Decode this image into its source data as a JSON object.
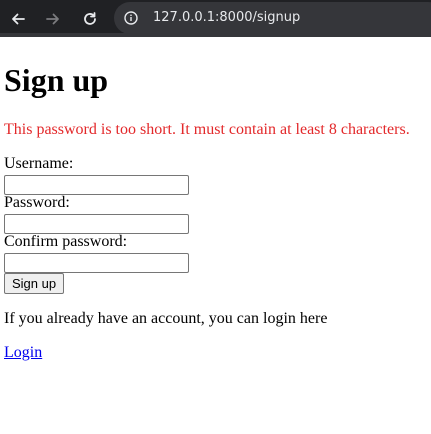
{
  "browser": {
    "url": "127.0.0.1:8000/signup",
    "icons": {
      "back": "arrow-left-icon",
      "forward": "arrow-right-icon",
      "reload": "reload-icon",
      "site_info": "info-icon"
    },
    "colors": {
      "toolbar_bg": "#202124",
      "address_bg": "#35363a",
      "text": "#e8eaed"
    }
  },
  "page": {
    "title": "Sign up",
    "error": "This password is too short. It must contain at least 8 characters.",
    "form": {
      "username_label": "Username:",
      "username_value": "",
      "password_label": "Password:",
      "password_value": "",
      "confirm_label": "Confirm password:",
      "confirm_value": "",
      "submit_label": "Sign up"
    },
    "account_text": "If you already have an account, you can login here",
    "login_link": "Login"
  },
  "colors": {
    "error": "#e3282a",
    "link": "#0000ee"
  }
}
